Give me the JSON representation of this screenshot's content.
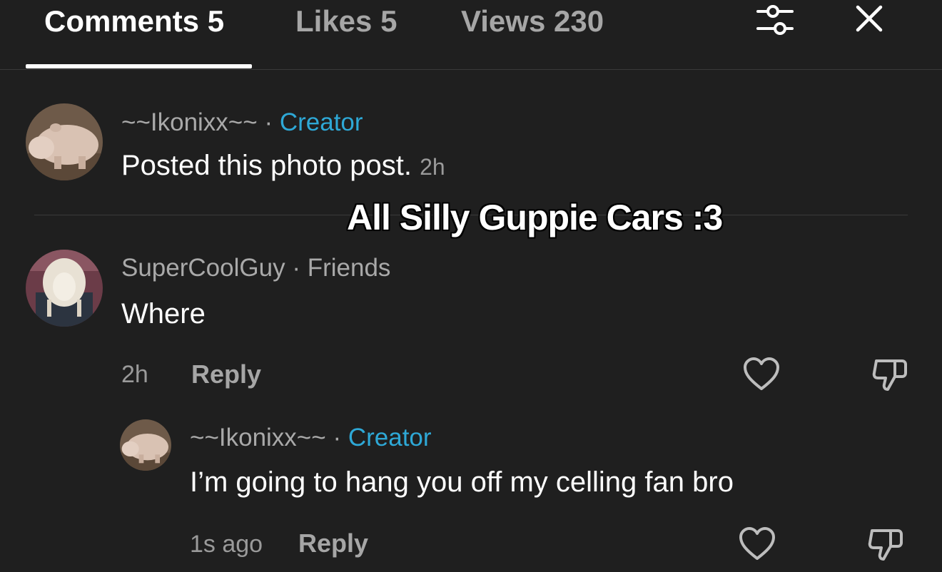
{
  "tabs": [
    {
      "label": "Comments 5",
      "active": true
    },
    {
      "label": "Likes 5",
      "active": false
    },
    {
      "label": "Views 230",
      "active": false
    }
  ],
  "header_icons": {
    "filter": "sliders-icon",
    "close": "close-icon"
  },
  "post": {
    "author": "~~Ikonixx~~",
    "separator": "·",
    "role": "Creator",
    "text": "Posted this photo post.",
    "time": "2h",
    "avatar": "hippo-avatar"
  },
  "overlay_caption": "All Silly Guppie Cars :3",
  "comments": [
    {
      "author": "SuperCoolGuy",
      "separator": "·",
      "relation": "Friends",
      "text": "Where",
      "time": "2h",
      "reply_label": "Reply",
      "avatar": "lion-avatar",
      "replies": [
        {
          "author": "~~Ikonixx~~",
          "separator": "·",
          "role": "Creator",
          "text": "I’m going to hang you off my celling fan bro",
          "time": "1s ago",
          "reply_label": "Reply",
          "avatar": "hippo-avatar"
        }
      ]
    }
  ],
  "colors": {
    "background": "#1f1f1f",
    "creator_accent": "#2ea8d6",
    "muted": "#a6a6a6"
  }
}
